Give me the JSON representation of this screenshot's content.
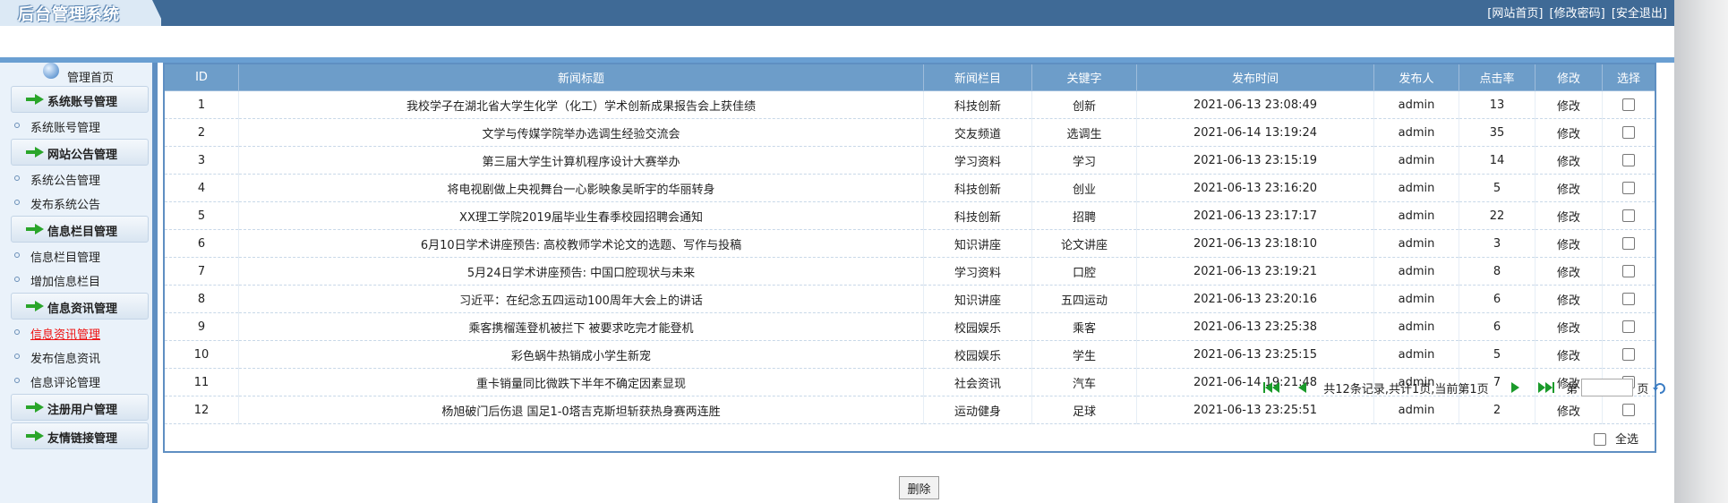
{
  "header": {
    "title": "后台管理系统",
    "links": [
      "[网站首页]",
      "[修改密码]",
      "[安全退出]"
    ]
  },
  "sidebar": {
    "home_label": "管理首页",
    "groups": [
      {
        "label": "系统账号管理",
        "items": [
          "系统账号管理"
        ]
      },
      {
        "label": "网站公告管理",
        "items": [
          "系统公告管理",
          "发布系统公告"
        ]
      },
      {
        "label": "信息栏目管理",
        "items": [
          "信息栏目管理",
          "增加信息栏目"
        ]
      },
      {
        "label": "信息资讯管理",
        "items": [
          "信息资讯管理",
          "发布信息资讯",
          "信息评论管理"
        ]
      },
      {
        "label": "注册用户管理",
        "items": []
      },
      {
        "label": "友情链接管理",
        "items": []
      }
    ],
    "active_item": "信息资讯管理"
  },
  "table": {
    "columns": [
      "ID",
      "新闻标题",
      "新闻栏目",
      "关键字",
      "发布时间",
      "发布人",
      "点击率",
      "修改",
      "选择"
    ],
    "rows": [
      {
        "id": "1",
        "title": "我校学子在湖北省大学生化学（化工）学术创新成果报告会上获佳绩",
        "category": "科技创新",
        "keyword": "创新",
        "time": "2021-06-13 23:08:49",
        "author": "admin",
        "hits": "13",
        "edit": "修改"
      },
      {
        "id": "2",
        "title": "文学与传媒学院举办选调生经验交流会",
        "category": "交友频道",
        "keyword": "选调生",
        "time": "2021-06-14 13:19:24",
        "author": "admin",
        "hits": "35",
        "edit": "修改"
      },
      {
        "id": "3",
        "title": "第三届大学生计算机程序设计大赛举办",
        "category": "学习资料",
        "keyword": "学习",
        "time": "2021-06-13 23:15:19",
        "author": "admin",
        "hits": "14",
        "edit": "修改"
      },
      {
        "id": "4",
        "title": "将电视剧做上央视舞台一心影映象吴昕宇的华丽转身",
        "category": "科技创新",
        "keyword": "创业",
        "time": "2021-06-13 23:16:20",
        "author": "admin",
        "hits": "5",
        "edit": "修改"
      },
      {
        "id": "5",
        "title": "XX理工学院2019届毕业生春季校园招聘会通知",
        "category": "科技创新",
        "keyword": "招聘",
        "time": "2021-06-13 23:17:17",
        "author": "admin",
        "hits": "22",
        "edit": "修改"
      },
      {
        "id": "6",
        "title": "6月10日学术讲座预告: 高校教师学术论文的选题、写作与投稿",
        "category": "知识讲座",
        "keyword": "论文讲座",
        "time": "2021-06-13 23:18:10",
        "author": "admin",
        "hits": "3",
        "edit": "修改"
      },
      {
        "id": "7",
        "title": "5月24日学术讲座预告: 中国口腔现状与未来",
        "category": "学习资料",
        "keyword": "口腔",
        "time": "2021-06-13 23:19:21",
        "author": "admin",
        "hits": "8",
        "edit": "修改"
      },
      {
        "id": "8",
        "title": "习近平：在纪念五四运动100周年大会上的讲话",
        "category": "知识讲座",
        "keyword": "五四运动",
        "time": "2021-06-13 23:20:16",
        "author": "admin",
        "hits": "6",
        "edit": "修改"
      },
      {
        "id": "9",
        "title": "乘客携榴莲登机被拦下 被要求吃完才能登机",
        "category": "校园娱乐",
        "keyword": "乘客",
        "time": "2021-06-13 23:25:38",
        "author": "admin",
        "hits": "6",
        "edit": "修改"
      },
      {
        "id": "10",
        "title": "彩色蜗牛热销成小学生新宠",
        "category": "校园娱乐",
        "keyword": "学生",
        "time": "2021-06-13 23:25:15",
        "author": "admin",
        "hits": "5",
        "edit": "修改"
      },
      {
        "id": "11",
        "title": "重卡销量同比微跌下半年不确定因素显现",
        "category": "社会资讯",
        "keyword": "汽车",
        "time": "2021-06-14 19:21:48",
        "author": "admin",
        "hits": "7",
        "edit": "修改"
      },
      {
        "id": "12",
        "title": "杨旭破门后伤退 国足1-0塔吉克斯坦斩获热身赛两连胜",
        "category": "运动健身",
        "keyword": "足球",
        "time": "2021-06-13 23:25:51",
        "author": "admin",
        "hits": "2",
        "edit": "修改"
      }
    ],
    "select_all_label": "全选"
  },
  "pager": {
    "summary": "共12条记录,共计1页,当前第1页",
    "goto_prefix": "第",
    "goto_suffix": "页",
    "page_input_value": ""
  },
  "delete_label": "删除",
  "colors": {
    "header_bg": "#3f6a96",
    "table_header": "#6d9dc9",
    "sidebar_bg": "#eaf2fa",
    "active_link": "#e11111"
  },
  "icons": [
    "globe-icon",
    "green-arrow-icon",
    "first-page-icon",
    "prev-page-icon",
    "next-page-icon",
    "last-page-icon",
    "refresh-icon"
  ]
}
